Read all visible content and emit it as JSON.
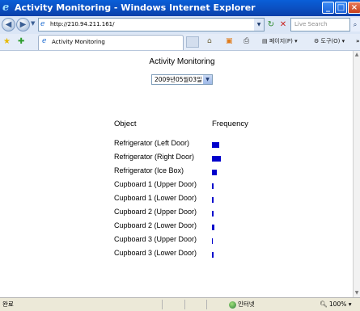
{
  "window": {
    "title": "Activity Monitoring - Windows Internet Explorer"
  },
  "address_bar": {
    "url": "http://210.94.211.161/",
    "search_placeholder": "Live Search"
  },
  "tabs": [
    {
      "label": "Activity Monitoring"
    }
  ],
  "command_bar": {
    "page_label": "페이지(P)",
    "tools_label": "도구(O)"
  },
  "page": {
    "title": "Activity Monitoring",
    "date_selected": "2009년05월03일",
    "col_object": "Object",
    "col_frequency": "Frequency",
    "bar_color": "#0000cc",
    "rows": [
      {
        "name": "Refrigerator (Left Door)",
        "frequency": 9
      },
      {
        "name": "Refrigerator (Right Door)",
        "frequency": 11
      },
      {
        "name": "Refrigerator (Ice Box)",
        "frequency": 6
      },
      {
        "name": "Cupboard 1 (Upper Door)",
        "frequency": 2
      },
      {
        "name": "Cupboard 1 (Lower Door)",
        "frequency": 2
      },
      {
        "name": "Cupboard 2 (Upper Door)",
        "frequency": 2
      },
      {
        "name": "Cupboard 2 (Lower Door)",
        "frequency": 3
      },
      {
        "name": "Cupboard 3 (Upper Door)",
        "frequency": 1
      },
      {
        "name": "Cupboard 3 (Lower Door)",
        "frequency": 2
      }
    ]
  },
  "status_bar": {
    "text": "완료",
    "zone": "인터넷",
    "zoom": "100%"
  }
}
